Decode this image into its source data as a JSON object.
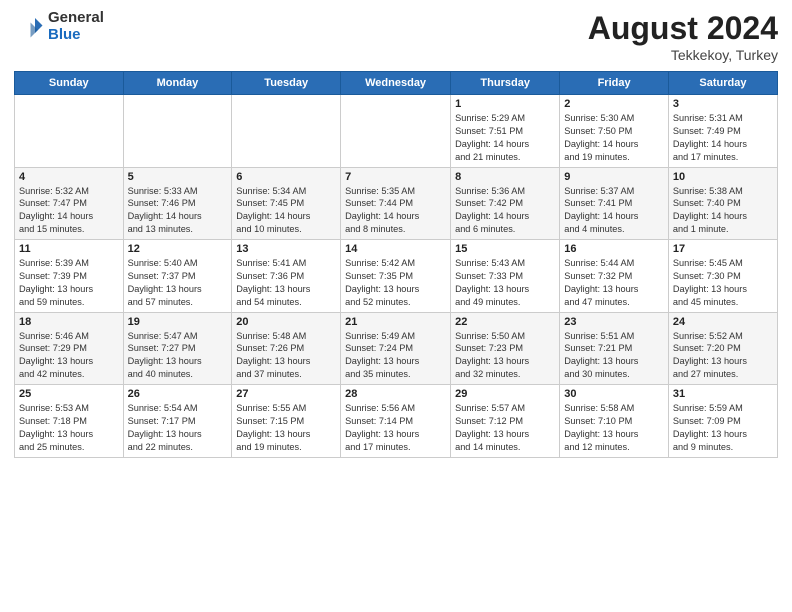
{
  "header": {
    "logo_general": "General",
    "logo_blue": "Blue",
    "title": "August 2024",
    "location": "Tekkekoy, Turkey"
  },
  "days_of_week": [
    "Sunday",
    "Monday",
    "Tuesday",
    "Wednesday",
    "Thursday",
    "Friday",
    "Saturday"
  ],
  "weeks": [
    [
      {
        "num": "",
        "info": ""
      },
      {
        "num": "",
        "info": ""
      },
      {
        "num": "",
        "info": ""
      },
      {
        "num": "",
        "info": ""
      },
      {
        "num": "1",
        "info": "Sunrise: 5:29 AM\nSunset: 7:51 PM\nDaylight: 14 hours\nand 21 minutes."
      },
      {
        "num": "2",
        "info": "Sunrise: 5:30 AM\nSunset: 7:50 PM\nDaylight: 14 hours\nand 19 minutes."
      },
      {
        "num": "3",
        "info": "Sunrise: 5:31 AM\nSunset: 7:49 PM\nDaylight: 14 hours\nand 17 minutes."
      }
    ],
    [
      {
        "num": "4",
        "info": "Sunrise: 5:32 AM\nSunset: 7:47 PM\nDaylight: 14 hours\nand 15 minutes."
      },
      {
        "num": "5",
        "info": "Sunrise: 5:33 AM\nSunset: 7:46 PM\nDaylight: 14 hours\nand 13 minutes."
      },
      {
        "num": "6",
        "info": "Sunrise: 5:34 AM\nSunset: 7:45 PM\nDaylight: 14 hours\nand 10 minutes."
      },
      {
        "num": "7",
        "info": "Sunrise: 5:35 AM\nSunset: 7:44 PM\nDaylight: 14 hours\nand 8 minutes."
      },
      {
        "num": "8",
        "info": "Sunrise: 5:36 AM\nSunset: 7:42 PM\nDaylight: 14 hours\nand 6 minutes."
      },
      {
        "num": "9",
        "info": "Sunrise: 5:37 AM\nSunset: 7:41 PM\nDaylight: 14 hours\nand 4 minutes."
      },
      {
        "num": "10",
        "info": "Sunrise: 5:38 AM\nSunset: 7:40 PM\nDaylight: 14 hours\nand 1 minute."
      }
    ],
    [
      {
        "num": "11",
        "info": "Sunrise: 5:39 AM\nSunset: 7:39 PM\nDaylight: 13 hours\nand 59 minutes."
      },
      {
        "num": "12",
        "info": "Sunrise: 5:40 AM\nSunset: 7:37 PM\nDaylight: 13 hours\nand 57 minutes."
      },
      {
        "num": "13",
        "info": "Sunrise: 5:41 AM\nSunset: 7:36 PM\nDaylight: 13 hours\nand 54 minutes."
      },
      {
        "num": "14",
        "info": "Sunrise: 5:42 AM\nSunset: 7:35 PM\nDaylight: 13 hours\nand 52 minutes."
      },
      {
        "num": "15",
        "info": "Sunrise: 5:43 AM\nSunset: 7:33 PM\nDaylight: 13 hours\nand 49 minutes."
      },
      {
        "num": "16",
        "info": "Sunrise: 5:44 AM\nSunset: 7:32 PM\nDaylight: 13 hours\nand 47 minutes."
      },
      {
        "num": "17",
        "info": "Sunrise: 5:45 AM\nSunset: 7:30 PM\nDaylight: 13 hours\nand 45 minutes."
      }
    ],
    [
      {
        "num": "18",
        "info": "Sunrise: 5:46 AM\nSunset: 7:29 PM\nDaylight: 13 hours\nand 42 minutes."
      },
      {
        "num": "19",
        "info": "Sunrise: 5:47 AM\nSunset: 7:27 PM\nDaylight: 13 hours\nand 40 minutes."
      },
      {
        "num": "20",
        "info": "Sunrise: 5:48 AM\nSunset: 7:26 PM\nDaylight: 13 hours\nand 37 minutes."
      },
      {
        "num": "21",
        "info": "Sunrise: 5:49 AM\nSunset: 7:24 PM\nDaylight: 13 hours\nand 35 minutes."
      },
      {
        "num": "22",
        "info": "Sunrise: 5:50 AM\nSunset: 7:23 PM\nDaylight: 13 hours\nand 32 minutes."
      },
      {
        "num": "23",
        "info": "Sunrise: 5:51 AM\nSunset: 7:21 PM\nDaylight: 13 hours\nand 30 minutes."
      },
      {
        "num": "24",
        "info": "Sunrise: 5:52 AM\nSunset: 7:20 PM\nDaylight: 13 hours\nand 27 minutes."
      }
    ],
    [
      {
        "num": "25",
        "info": "Sunrise: 5:53 AM\nSunset: 7:18 PM\nDaylight: 13 hours\nand 25 minutes."
      },
      {
        "num": "26",
        "info": "Sunrise: 5:54 AM\nSunset: 7:17 PM\nDaylight: 13 hours\nand 22 minutes."
      },
      {
        "num": "27",
        "info": "Sunrise: 5:55 AM\nSunset: 7:15 PM\nDaylight: 13 hours\nand 19 minutes."
      },
      {
        "num": "28",
        "info": "Sunrise: 5:56 AM\nSunset: 7:14 PM\nDaylight: 13 hours\nand 17 minutes."
      },
      {
        "num": "29",
        "info": "Sunrise: 5:57 AM\nSunset: 7:12 PM\nDaylight: 13 hours\nand 14 minutes."
      },
      {
        "num": "30",
        "info": "Sunrise: 5:58 AM\nSunset: 7:10 PM\nDaylight: 13 hours\nand 12 minutes."
      },
      {
        "num": "31",
        "info": "Sunrise: 5:59 AM\nSunset: 7:09 PM\nDaylight: 13 hours\nand 9 minutes."
      }
    ]
  ]
}
